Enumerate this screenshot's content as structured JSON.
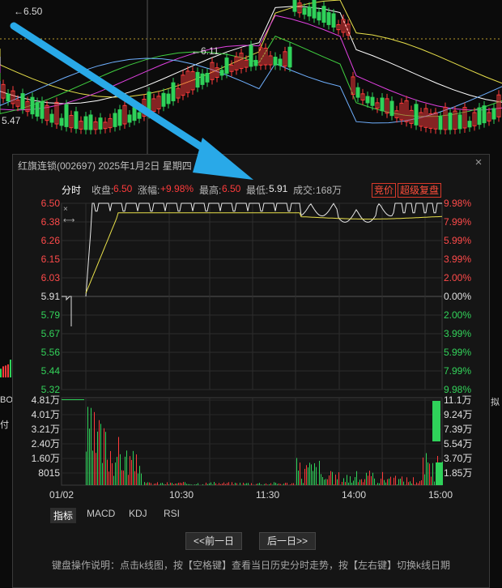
{
  "background": {
    "top_price_label": "←6.50",
    "mid_price_label": "←6.11",
    "left_price_label": "5.47",
    "cut_label_1": "BOLI",
    "cut_label_2": "付",
    "cut_label_3": "拟"
  },
  "popup": {
    "title": "红旗连锁(002697) 2025年1月2日 星期四",
    "close_icon": "×",
    "info": {
      "mode": "分时",
      "close_label": "收盘:",
      "close_value": "6.50",
      "change_label": "涨幅:",
      "change_value": "+9.98%",
      "high_label": "最高:",
      "high_value": "6.50",
      "low_label": "最低:",
      "low_value": "5.91",
      "volume_label": "成交:",
      "volume_value": "168万",
      "auction_button": "竞价",
      "restore_button": "超级复盘"
    },
    "price_ticks": [
      "6.50",
      "6.38",
      "6.26",
      "6.15",
      "6.03",
      "5.91",
      "5.79",
      "5.67",
      "5.56",
      "5.44",
      "5.32"
    ],
    "percent_ticks": [
      "9.98%",
      "7.99%",
      "5.99%",
      "3.99%",
      "2.00%",
      "0.00%",
      "2.00%",
      "3.99%",
      "5.99%",
      "7.99%",
      "9.98%"
    ],
    "volume_ticks_left": [
      "4.81万",
      "4.01万",
      "3.21万",
      "2.40万",
      "1.60万",
      "8015"
    ],
    "volume_ticks_right": [
      "11.1万",
      "9.24万",
      "7.39万",
      "5.54万",
      "3.70万",
      "1.85万"
    ],
    "time_ticks": [
      "01/02",
      "10:30",
      "11:30",
      "14:00",
      "15:00"
    ],
    "tabs": [
      "指标",
      "MACD",
      "KDJ",
      "RSI"
    ],
    "prev_day_button": "<<前一日",
    "next_day_button": "后一日>>",
    "help_text": "键盘操作说明：点击k线图，按【空格键】查看当日历史分时走势，按【左右键】切换k线日期"
  },
  "colors": {
    "up": "#ff3b3b",
    "down": "#2fd25a",
    "avg_line": "#e8e04a",
    "price_line": "#e8e8e8",
    "arrow": "#29a9e8"
  }
}
